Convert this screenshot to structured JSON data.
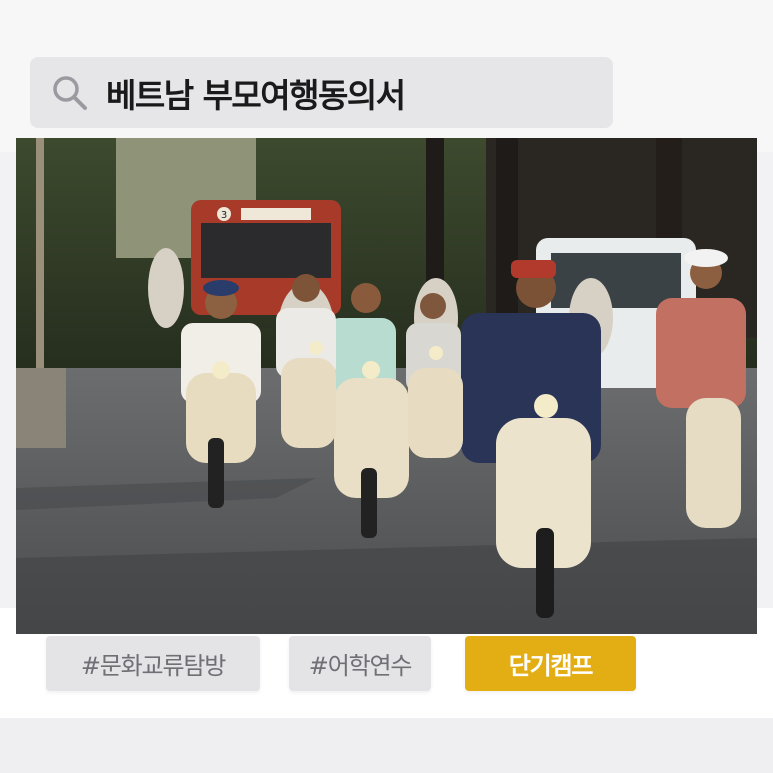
{
  "search": {
    "query": "베트남 부모여행동의서",
    "icon": "search-icon"
  },
  "photo": {
    "bus_sign": "3",
    "description_icon": "photo-image"
  },
  "tags": [
    {
      "label": "#문화교류탐방",
      "active": false
    },
    {
      "label": "#어학연수",
      "active": false
    },
    {
      "label": "단기캠프",
      "active": true
    }
  ],
  "colors": {
    "accent": "#e3ad14",
    "tag_bg": "#e4e4e7",
    "tag_text": "#6f6f75",
    "search_bg": "#e6e6e9"
  }
}
